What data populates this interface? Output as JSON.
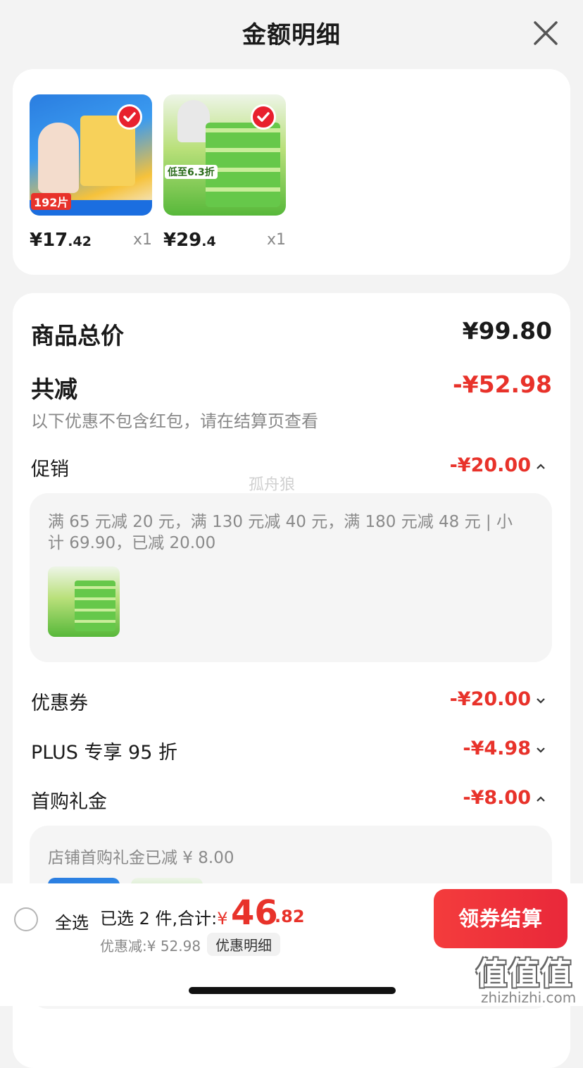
{
  "header": {
    "title": "金额明细"
  },
  "products": [
    {
      "price_int": "¥17",
      "price_dec": ".42",
      "qty": "x1",
      "badge": "192片"
    },
    {
      "price_int": "¥29",
      "price_dec": ".4",
      "qty": "x1",
      "badge": "低至6.3折"
    }
  ],
  "summary": {
    "total_label": "商品总价",
    "total_value": "¥99.80",
    "reduce_label": "共减",
    "reduce_value": "-¥52.98",
    "note": "以下优惠不包含红包，请在结算页查看"
  },
  "promo": {
    "label": "促销",
    "value": "-¥20.00",
    "desc": "满 65 元减 20 元，满 130 元减 40 元，满 180 元减 48 元 | 小计 69.90，已减 20.00"
  },
  "coupon": {
    "label": "优惠券",
    "value": "-¥20.00"
  },
  "plus": {
    "label": "PLUS 专享 95 折",
    "value": "-¥4.98"
  },
  "first_buy": {
    "label": "首购礼金",
    "value": "-¥8.00",
    "desc": "店铺首购礼金已减 ¥ 8.00"
  },
  "watermark": "孤舟狼",
  "bottom": {
    "select_all": "全选",
    "selected_text": "已选 2 件,合计:",
    "currency": "¥",
    "total_int": "46",
    "total_dec": ".82",
    "discount_text": "优惠减:¥ 52.98",
    "detail_link": "优惠明细",
    "checkout": "领券结算"
  },
  "site_logo": "值值值",
  "site_url": "zhizhizhi.com"
}
